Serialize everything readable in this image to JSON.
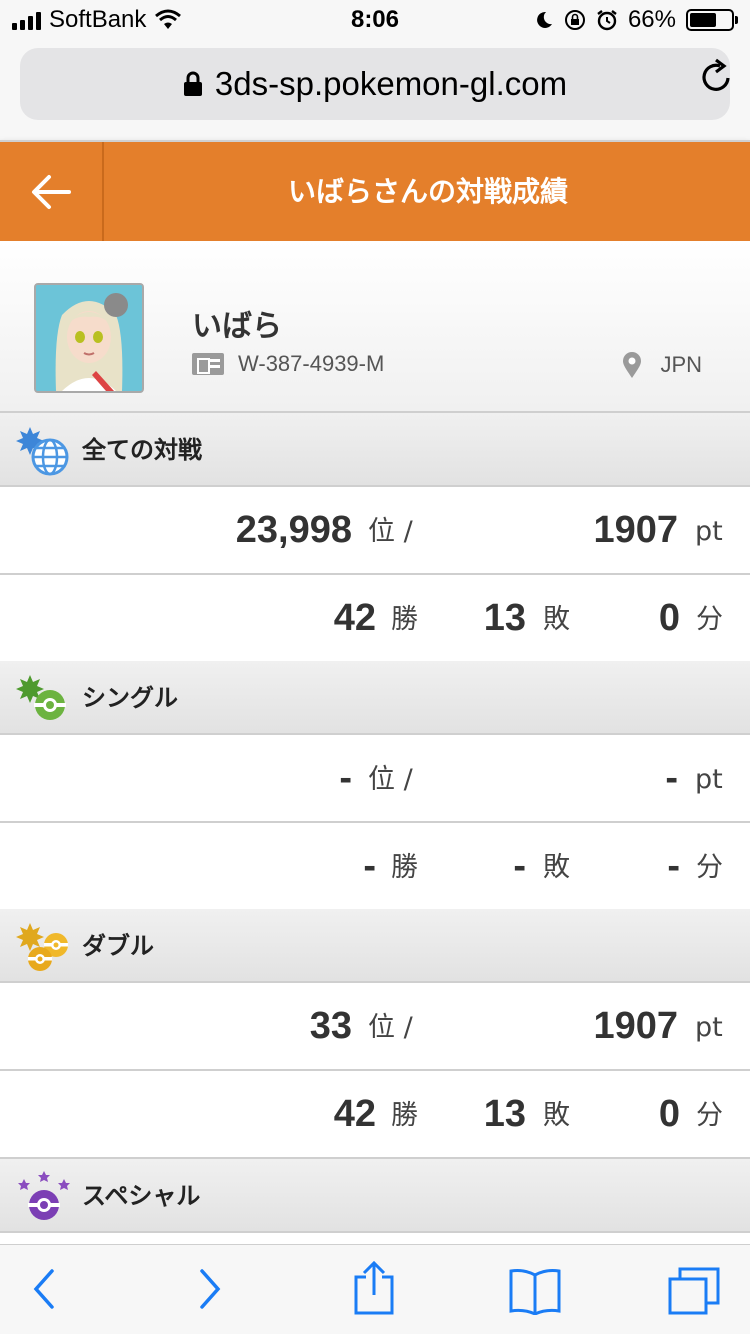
{
  "status_bar": {
    "carrier": "SoftBank",
    "time": "8:06",
    "battery": "66%",
    "battery_level": 0.66
  },
  "browser": {
    "url": "3ds-sp.pokemon-gl.com"
  },
  "header": {
    "title": "いばらさんの対戦成績"
  },
  "profile": {
    "name": "いばら",
    "id": "W-387-4939-M",
    "region": "JPN"
  },
  "sections": {
    "all": {
      "label": "全ての対戦",
      "rank": "23,998",
      "rank_unit": "位 /",
      "points": "1907",
      "points_unit": "pt",
      "wins": "42",
      "wins_unit": "勝",
      "losses": "13",
      "losses_unit": "敗",
      "draws": "0",
      "draws_unit": "分"
    },
    "single": {
      "label": "シングル",
      "rank": "-",
      "rank_unit": "位 /",
      "points": "-",
      "points_unit": "pt",
      "wins": "-",
      "wins_unit": "勝",
      "losses": "-",
      "losses_unit": "敗",
      "draws": "-",
      "draws_unit": "分"
    },
    "double": {
      "label": "ダブル",
      "rank": "33",
      "rank_unit": "位 /",
      "points": "1907",
      "points_unit": "pt",
      "wins": "42",
      "wins_unit": "勝",
      "losses": "13",
      "losses_unit": "敗",
      "draws": "0",
      "draws_unit": "分"
    },
    "special": {
      "label": "スペシャル"
    }
  },
  "colors": {
    "header_bg": "#e47f2b",
    "ios_blue": "#1a7cf5"
  },
  "icons": [
    "back-arrow-icon",
    "lock-icon",
    "reload-icon",
    "trainer-card-icon",
    "location-pin-icon",
    "globe-icon",
    "single-battle-icon",
    "double-battle-icon",
    "special-battle-icon",
    "share-icon",
    "bookmarks-icon",
    "tabs-icon"
  ]
}
